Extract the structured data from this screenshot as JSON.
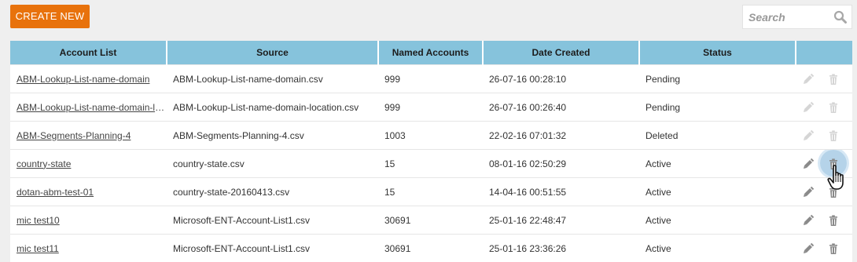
{
  "toolbar": {
    "create_label": "CREATE NEW",
    "search_placeholder": "Search"
  },
  "table": {
    "columns": [
      "Account List",
      "Source",
      "Named Accounts",
      "Date Created",
      "Status",
      ""
    ],
    "rows": [
      {
        "name": "ABM-Lookup-List-name-domain",
        "source": "ABM-Lookup-List-name-domain.csv",
        "count": "999",
        "date": "26-07-16 00:28:10",
        "status": "Pending",
        "actions_enabled": false
      },
      {
        "name": "ABM-Lookup-List-name-domain-location",
        "source": "ABM-Lookup-List-name-domain-location.csv",
        "count": "999",
        "date": "26-07-16 00:26:40",
        "status": "Pending",
        "actions_enabled": false
      },
      {
        "name": "ABM-Segments-Planning-4",
        "source": "ABM-Segments-Planning-4.csv",
        "count": "1003",
        "date": "22-02-16 07:01:32",
        "status": "Deleted",
        "actions_enabled": false
      },
      {
        "name": "country-state",
        "source": "country-state.csv",
        "count": "15",
        "date": "08-01-16 02:50:29",
        "status": "Active",
        "actions_enabled": true
      },
      {
        "name": "dotan-abm-test-01",
        "source": "country-state-20160413.csv",
        "count": "15",
        "date": "14-04-16 00:51:55",
        "status": "Active",
        "actions_enabled": true
      },
      {
        "name": "mic test10",
        "source": "Microsoft-ENT-Account-List1.csv",
        "count": "30691",
        "date": "25-01-16 22:48:47",
        "status": "Active",
        "actions_enabled": true
      },
      {
        "name": "mic test11",
        "source": "Microsoft-ENT-Account-List1.csv",
        "count": "30691",
        "date": "25-01-16 23:36:26",
        "status": "Active",
        "actions_enabled": true
      }
    ]
  },
  "icons": {
    "edit": "pencil-icon",
    "delete": "trash-icon",
    "search": "magnifier-icon",
    "cursor": "hand-pointer-icon"
  },
  "colors": {
    "accent": "#e8720c",
    "header": "#86c3dc",
    "background": "#efefef"
  }
}
